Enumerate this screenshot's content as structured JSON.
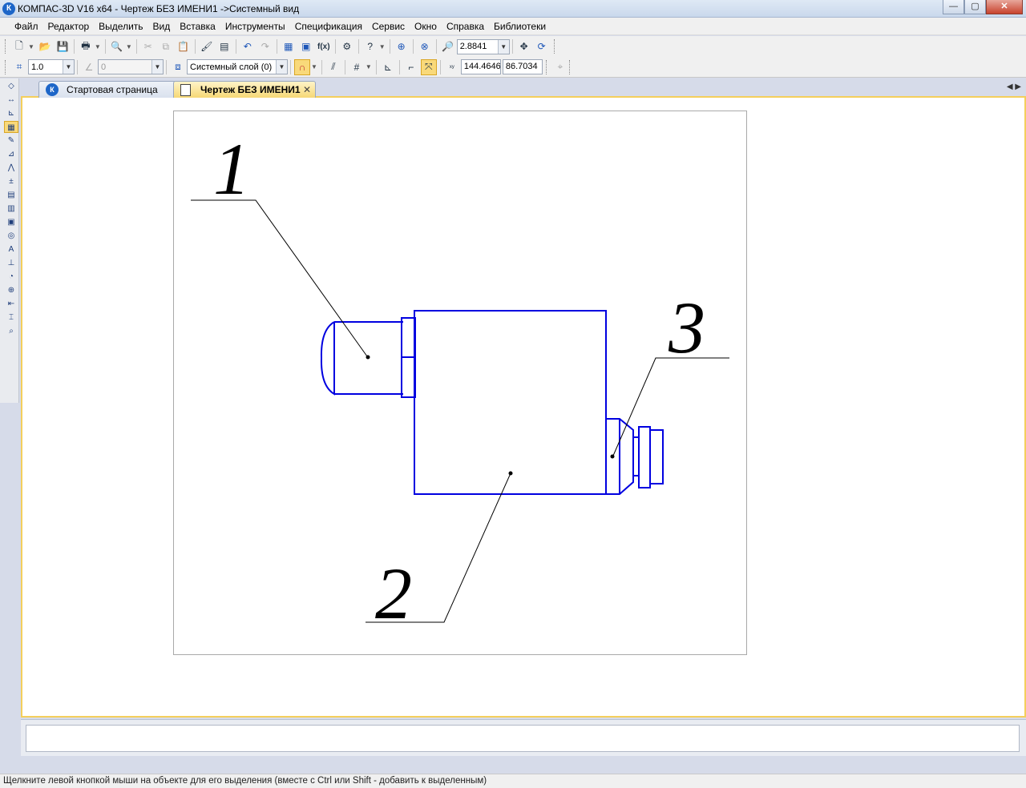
{
  "window": {
    "title": "КОМПАС-3D V16  x64 - Чертеж БЕЗ ИМЕНИ1 ->Системный вид",
    "app_icon": "К",
    "minimize": "—",
    "maximize": "▢",
    "close": "✕"
  },
  "menu": [
    "Файл",
    "Редактор",
    "Выделить",
    "Вид",
    "Вставка",
    "Инструменты",
    "Спецификация",
    "Сервис",
    "Окно",
    "Справка",
    "Библиотеки"
  ],
  "toolbar1": {
    "icons": [
      "new-doc-icon",
      "open-icon",
      "save-icon",
      "print-icon",
      "preview-icon",
      "cut-icon",
      "copy-icon",
      "paste-icon",
      "format-brush-icon",
      "properties-icon",
      "undo-icon",
      "redo-icon",
      "tree-icon",
      "manager-icon",
      "variables-icon",
      "library-icon",
      "help-pointer-icon",
      "zoom-window-icon",
      "zoom-all-icon",
      "zoom-icon"
    ],
    "zoom_value": "2.8841",
    "fx_label": "f(x)"
  },
  "toolbar2": {
    "step_value": "1.0",
    "angle_value": "0",
    "layer_value": "Системный слой (0)",
    "coord_x": "144.4646",
    "coord_y": "86.7034"
  },
  "tabs": [
    {
      "label": "Стартовая страница",
      "icon": "kompas-logo-icon"
    },
    {
      "label": "Чертеж БЕЗ ИМЕНИ1",
      "icon": "drawing-doc-icon",
      "close": "✕"
    }
  ],
  "tab_scroll": "◀ ▶",
  "status": {
    "text": "Щелкните левой кнопкой мыши на объекте для его выделения (вместе с Ctrl или Shift - добавить к выделенным)"
  },
  "colors": {
    "geometry": "#0000e0",
    "leader": "#000000",
    "active_tab": "#f6d876"
  },
  "drawing": {
    "callouts": [
      "1",
      "2",
      "3"
    ]
  }
}
